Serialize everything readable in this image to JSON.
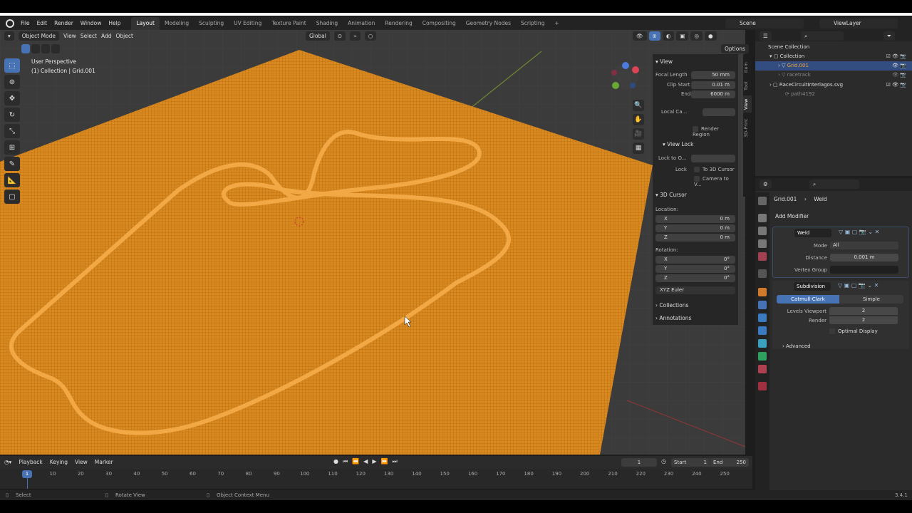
{
  "menu": {
    "file": "File",
    "edit": "Edit",
    "render": "Render",
    "window": "Window",
    "help": "Help",
    "tabs": [
      "Layout",
      "Modeling",
      "Sculpting",
      "UV Editing",
      "Texture Paint",
      "Shading",
      "Animation",
      "Rendering",
      "Compositing",
      "Geometry Nodes",
      "Scripting"
    ],
    "add_tab": "+",
    "scene": "Scene",
    "view_layer": "ViewLayer"
  },
  "viewport": {
    "mode": "Object Mode",
    "view": "View",
    "select": "Select",
    "add": "Add",
    "object": "Object",
    "orientation": "Global",
    "options": "Options",
    "perspective": "User Perspective",
    "collection_info": "(1) Collection | Grid.001"
  },
  "npanel": {
    "view_title": "View",
    "focal_length_label": "Focal Length",
    "focal_length": "50 mm",
    "clip_start_label": "Clip Start",
    "clip_start": "0.01 m",
    "end_label": "End",
    "end": "6000 m",
    "local_camera_label": "Local Ca...",
    "render_region": "Render Region",
    "view_lock_title": "View Lock",
    "lock_to_label": "Lock to O...",
    "lock_label": "Lock",
    "to_3d_cursor": "To 3D Cursor",
    "camera_to_view": "Camera to V...",
    "cursor_title": "3D Cursor",
    "location_label": "Location:",
    "x": "X",
    "y": "Y",
    "z": "Z",
    "loc_x": "0 m",
    "loc_y": "0 m",
    "loc_z": "0 m",
    "rotation_label": "Rotation:",
    "rot_x": "0°",
    "rot_y": "0°",
    "rot_z": "0°",
    "rotation_mode": "XYZ Euler",
    "collections": "Collections",
    "annotations": "Annotations",
    "tabs": [
      "Item",
      "Tool",
      "View",
      "3D-Print"
    ]
  },
  "outliner": {
    "scene_collection": "Scene Collection",
    "collection": "Collection",
    "grid": "Grid.001",
    "racetrack": "racetrack",
    "svg": "RaceCircuitInterlagos.svg",
    "path": "path4192"
  },
  "properties": {
    "object": "Grid.001",
    "modifier": "Weld",
    "add_modifier": "Add Modifier",
    "weld_name": "Weld",
    "mode_label": "Mode",
    "mode_value": "All",
    "distance_label": "Distance",
    "distance_value": "0.001 m",
    "vertex_group_label": "Vertex Group",
    "subdiv_name": "Subdivision",
    "catmull": "Catmull-Clark",
    "simple": "Simple",
    "levels_viewport_label": "Levels Viewport",
    "levels_viewport": "2",
    "render_label": "Render",
    "render_value": "2",
    "optimal_display": "Optimal Display",
    "advanced": "Advanced"
  },
  "timeline": {
    "playback": "Playback",
    "keying": "Keying",
    "view": "View",
    "marker": "Marker",
    "current_frame": "1",
    "start_label": "Start",
    "start": "1",
    "end_label": "End",
    "end": "250",
    "frame_marker": "1",
    "ticks": [
      "10",
      "20",
      "30",
      "40",
      "50",
      "60",
      "70",
      "80",
      "90",
      "100",
      "110",
      "120",
      "130",
      "140",
      "150",
      "160",
      "170",
      "180",
      "190",
      "200",
      "210",
      "220",
      "230",
      "240",
      "250"
    ]
  },
  "status": {
    "select": "Select",
    "rotate": "Rotate View",
    "context": "Object Context Menu",
    "version": "3.4.1"
  },
  "colors": {
    "accent": "#4772b3",
    "mesh": "#d9891f",
    "track": "#f0a03a",
    "selected_text": "#f0a03a"
  }
}
